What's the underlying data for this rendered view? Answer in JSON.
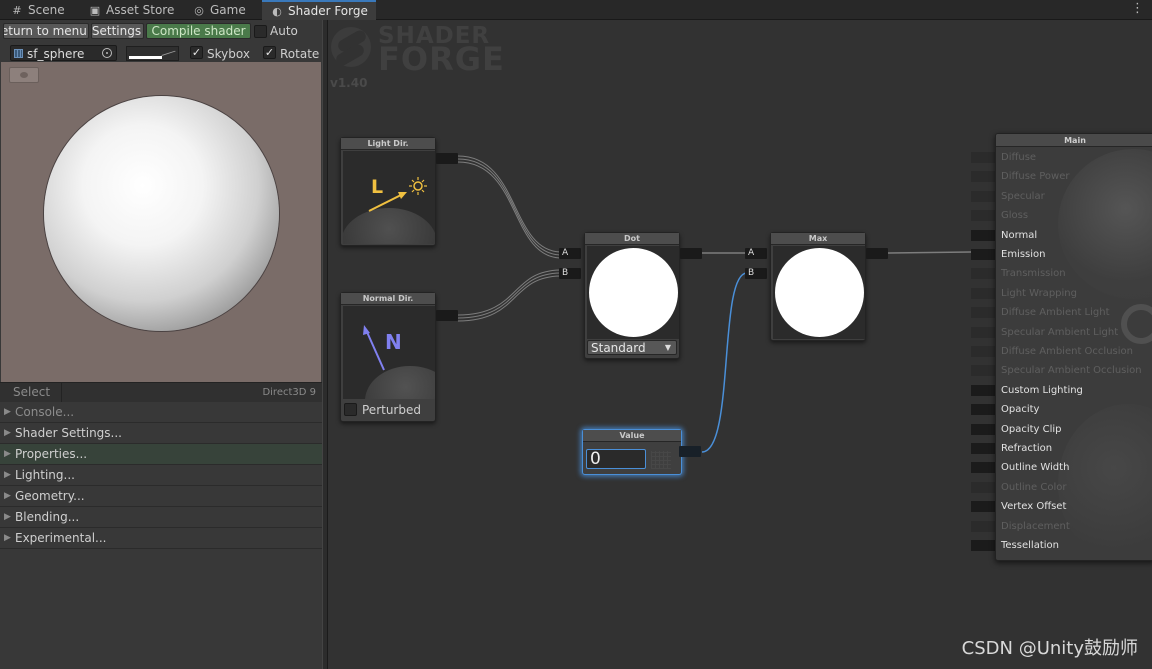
{
  "tabs": [
    {
      "label": "Scene",
      "icon": "#"
    },
    {
      "label": "Asset Store",
      "icon": "▣"
    },
    {
      "label": "Game",
      "icon": "◎"
    },
    {
      "label": "Shader Forge",
      "icon": "◐"
    }
  ],
  "tab_menu_icon": "⋮",
  "toolbar": {
    "return_label": "Return to menu",
    "settings_label": "Settings",
    "compile_label": "Compile shader",
    "auto_label": "Auto",
    "mesh_value": "sf_sphere",
    "skybox_label": "Skybox",
    "rotate_label": "Rotate",
    "check_mark": "✓"
  },
  "status": {
    "select_label": "Select",
    "renderer": "Direct3D 9"
  },
  "sections": [
    "Console...",
    "Shader Settings...",
    "Properties...",
    "Lighting...",
    "Geometry...",
    "Blending...",
    "Experimental..."
  ],
  "logo": {
    "line1": "SHADER",
    "line2": "FORGE",
    "version": "v1.40"
  },
  "nodes": {
    "light_dir": {
      "title": "Light Dir.",
      "glyph": "L"
    },
    "normal_dir": {
      "title": "Normal Dir.",
      "glyph": "N",
      "perturbed_label": "Perturbed"
    },
    "dot": {
      "title": "Dot",
      "port_a": "A",
      "port_b": "B",
      "mode": "Standard"
    },
    "max": {
      "title": "Max",
      "port_a": "A",
      "port_b": "B"
    },
    "value": {
      "title": "Value",
      "value": "0"
    }
  },
  "main_node": {
    "title": "Main",
    "inputs": [
      {
        "label": "Diffuse",
        "active": false
      },
      {
        "label": "Diffuse Power",
        "active": false
      },
      {
        "label": "Specular",
        "active": false
      },
      {
        "label": "Gloss",
        "active": false
      },
      {
        "label": "Normal",
        "active": true
      },
      {
        "label": "Emission",
        "active": true
      },
      {
        "label": "Transmission",
        "active": false
      },
      {
        "label": "Light Wrapping",
        "active": false
      },
      {
        "label": "Diffuse Ambient Light",
        "active": false
      },
      {
        "label": "Specular Ambient Light",
        "active": false
      },
      {
        "label": "Diffuse Ambient Occlusion",
        "active": false
      },
      {
        "label": "Specular Ambient Occlusion",
        "active": false
      },
      {
        "label": "Custom Lighting",
        "active": true
      },
      {
        "label": "Opacity",
        "active": true
      },
      {
        "label": "Opacity Clip",
        "active": true
      },
      {
        "label": "Refraction",
        "active": true
      },
      {
        "label": "Outline Width",
        "active": true
      },
      {
        "label": "Outline Color",
        "active": false
      },
      {
        "label": "Vertex Offset",
        "active": true
      },
      {
        "label": "Displacement",
        "active": false
      },
      {
        "label": "Tessellation",
        "active": true
      }
    ]
  },
  "watermark": "CSDN @Unity鼓励师",
  "colors": {
    "accent": "#3a79bb",
    "compile_button": "#4a7a4a",
    "light_glyph": "#f0c040",
    "normal_glyph": "#8080f0",
    "selection_glow": "#4a8fd8"
  }
}
